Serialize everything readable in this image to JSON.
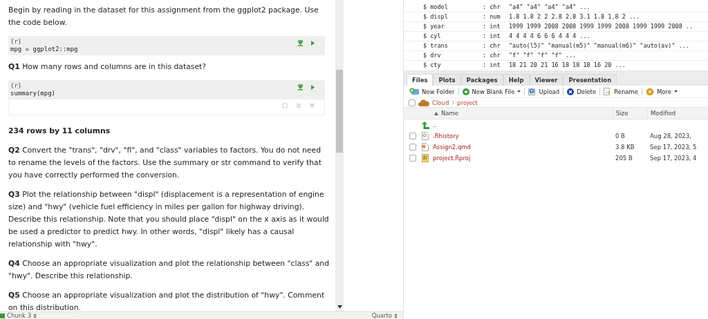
{
  "editor": {
    "blocks": [
      {
        "kind": "text",
        "text": "Begin by reading in the dataset for this assignment from the ggplot2 package. Use the code below."
      },
      {
        "kind": "chunk",
        "header": "{r}",
        "code": "mpg = ggplot2::mpg"
      },
      {
        "kind": "text",
        "text": "**Q1** How many rows and columns are in this dataset?"
      },
      {
        "kind": "chunk",
        "header": "{r}",
        "code": "summary(mpg)",
        "output": true
      },
      {
        "kind": "answer",
        "text": "234 rows by 11 columns"
      },
      {
        "kind": "text",
        "text": "**Q2** Convert the \"trans\", \"drv\", \"fl\", and \"class\" variables to factors. You do not need to rename the levels of the factors. Use the summary or str command to verify that you have correctly performed the conversion."
      },
      {
        "kind": "text",
        "text": "**Q3** Plot the relationship between \"displ\" (displacement is a representation of engine size) and \"hwy\" (vehicle fuel efficiency in miles per gallon for highway driving). Describe this relationship. Note that you should place \"displ\" on the x axis as it would be used a predictor to predict hwy. In other words, \"displ\" likely has a causal relationship with \"hwy\"."
      },
      {
        "kind": "text",
        "text": "**Q4** Choose an appropriate visualization and plot the relationship between \"class\" and \"hwy\". Describe this relationship."
      },
      {
        "kind": "text",
        "text": "**Q5** Choose an appropriate visualization and plot the distribution of \"hwy\". Comment on this distribution."
      }
    ]
  },
  "status_bar": {
    "chunk": "Chunk 3",
    "mode": "Quarto"
  },
  "console": {
    "lines": [
      {
        "name": "$ model",
        "type": ": chr",
        "values": "\"a4\" \"a4\" \"a4\" \"a4\" ..."
      },
      {
        "name": "$ displ",
        "type": ": num",
        "values": "1.8 1.8 2 2 2.8 2.8 3.1 1.8 1.8 2 ..."
      },
      {
        "name": "$ year",
        "type": ": int",
        "values": "1999 1999 2008 2008 1999 1999 2008 1999 1999 2008 .."
      },
      {
        "name": "$ cyl",
        "type": ": int",
        "values": "4 4 4 4 6 6 6 4 4 4 ..."
      },
      {
        "name": "$ trans",
        "type": ": chr",
        "values": "\"auto(l5)\" \"manual(m5)\" \"manual(m6)\" \"auto(av)\" ..."
      },
      {
        "name": "$ drv",
        "type": ": chr",
        "values": "\"f\" \"f\" \"f\" \"f\" ..."
      },
      {
        "name": "$ cty",
        "type": ": int",
        "values": "18 21 20 21 16 18 18 18 16 20 ..."
      }
    ]
  },
  "files": {
    "tabs": [
      {
        "label": "Files",
        "selected": true
      },
      {
        "label": "Plots",
        "selected": false
      },
      {
        "label": "Packages",
        "selected": false
      },
      {
        "label": "Help",
        "selected": false
      },
      {
        "label": "Viewer",
        "selected": false
      },
      {
        "label": "Presentation",
        "selected": false
      }
    ],
    "toolbar": [
      {
        "kind": "folder",
        "label": "New Folder",
        "dropdown": false
      },
      {
        "kind": "new",
        "label": "New Blank File",
        "dropdown": true
      },
      {
        "kind": "upload",
        "label": "Upload",
        "dropdown": false
      },
      {
        "kind": "delete",
        "label": "Delete",
        "dropdown": false
      },
      {
        "kind": "rename",
        "label": "Rename",
        "dropdown": false
      },
      {
        "kind": "more",
        "label": "More",
        "dropdown": true
      }
    ],
    "select_all": {
      "checked": false
    },
    "breadcrumb": [
      "Cloud",
      "project"
    ],
    "columns": [
      "Name",
      "Size",
      "Modified"
    ],
    "parent": "..",
    "rows": [
      {
        "kind": "history",
        "name": ".Rhistory",
        "size": "0 B",
        "modified": "Aug 28, 2023,",
        "checked": false
      },
      {
        "kind": "quarto",
        "name": "Assign2.qmd",
        "size": "3.8 KB",
        "modified": "Sep 17, 2023, 5",
        "checked": false
      },
      {
        "kind": "project",
        "name": "project.Rproj",
        "size": "205 B",
        "modified": "Sep 17, 2023, 4",
        "checked": false
      }
    ]
  }
}
